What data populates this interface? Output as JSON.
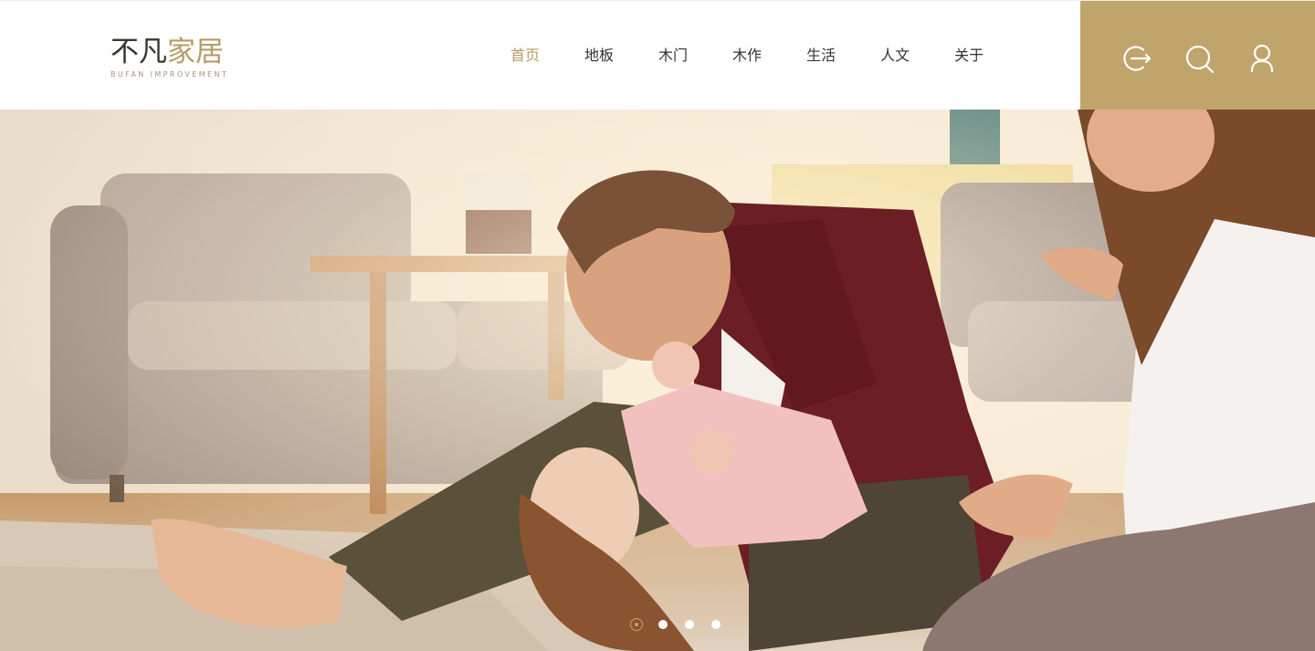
{
  "brand": {
    "name_part1": "不凡",
    "name_part2": "家居",
    "tagline": "BUFAN IMPROVEMENT",
    "accent_color": "#bfa46b"
  },
  "nav": {
    "items": [
      {
        "label": "首页",
        "active": true
      },
      {
        "label": "地板"
      },
      {
        "label": "木门"
      },
      {
        "label": "木作"
      },
      {
        "label": "生活"
      },
      {
        "label": "人文"
      },
      {
        "label": "关于"
      }
    ]
  },
  "toolbar": {
    "icons": [
      "logout-icon",
      "search-icon",
      "user-icon"
    ]
  },
  "hero": {
    "image_subject": "family-playing-on-living-room-floor",
    "slides": 4,
    "active_slide": 1
  }
}
